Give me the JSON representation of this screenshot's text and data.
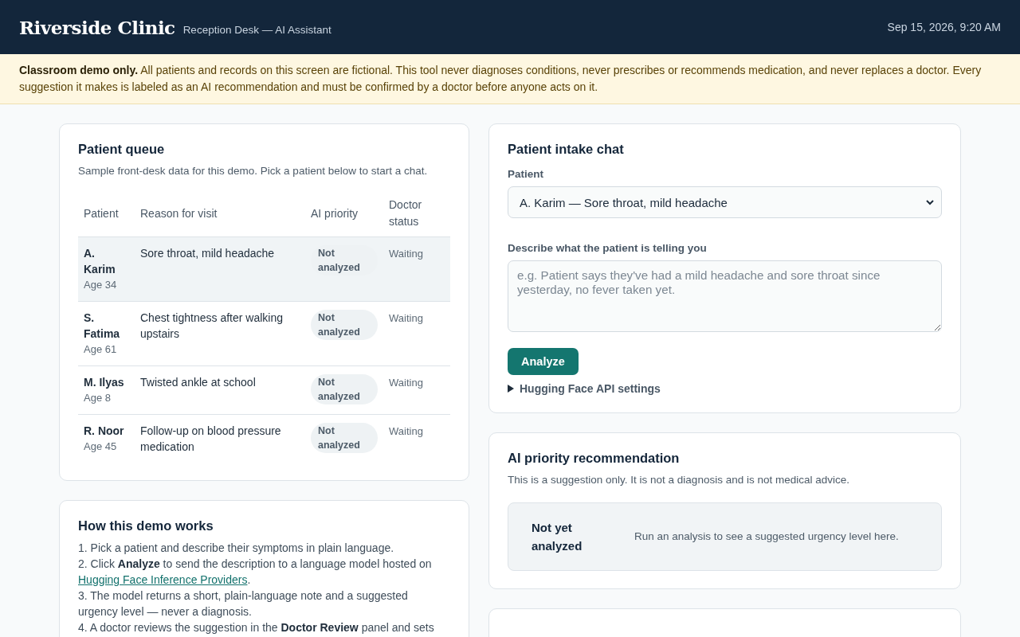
{
  "header": {
    "title": "Riverside Clinic",
    "subtitle": "Reception Desk — AI Assistant",
    "datetime": "Sep 15, 2026, 9:20 AM"
  },
  "notice": {
    "text": "**Classroom demo only.** All patients and records on this screen are fictional. This tool never diagnoses conditions, never prescribes or recommends medication, and never replaces a doctor. Every suggestion it makes is labeled as an AI recommendation and must be confirmed by a doctor before anyone acts on it."
  },
  "queue": {
    "title": "Patient queue",
    "subtitle": "Sample front-desk data for this demo. Pick a patient below to start a chat.",
    "columns": [
      "Patient",
      "Reason for visit",
      "AI priority",
      "Doctor status"
    ],
    "rows": [
      {
        "name": "A. Karim",
        "age": "Age 34",
        "reason": "Sore throat, mild headache",
        "priority": "Not analyzed",
        "status": "Waiting",
        "selected": true
      },
      {
        "name": "S. Fatima",
        "age": "Age 61",
        "reason": "Chest tightness after walking upstairs",
        "priority": "Not analyzed",
        "status": "Waiting",
        "selected": false
      },
      {
        "name": "M. Ilyas",
        "age": "Age 8",
        "reason": "Twisted ankle at school",
        "priority": "Not analyzed",
        "status": "Waiting",
        "selected": false
      },
      {
        "name": "R. Noor",
        "age": "Age 45",
        "reason": "Follow-up on blood pressure medication",
        "priority": "Not analyzed",
        "status": "Waiting",
        "selected": false
      }
    ]
  },
  "how": {
    "title": "How this demo works",
    "steps": [
      {
        "text": "1. Pick a patient and describe their symptoms in plain language."
      },
      {
        "text": "2. Click **Analyze** to send the description to a language model hosted on",
        "link": "Hugging Face Inference Providers",
        "after": "."
      },
      {
        "text": "3. The model returns a short, plain-language note and a suggested urgency level — never a diagnosis."
      },
      {
        "text": "4. A doctor reviews the suggestion in the **Doctor Review** panel and sets"
      }
    ]
  },
  "intake": {
    "title": "Patient intake chat",
    "patient_label": "Patient",
    "patient_value": "A. Karim — Sore throat, mild headache",
    "describe_label": "Describe what the patient is telling you",
    "placeholder": "e.g. Patient says they've had a mild headache and sore throat since yesterday, no fever taken yet.",
    "button": "Analyze",
    "settings": {
      "label": "Hugging Face API settings",
      "expanded": false
    }
  },
  "recommendation": {
    "title": "AI priority recommendation",
    "note": "This is a suggestion only. It is not a diagnosis and is not medical advice.",
    "status": "Not yet analyzed",
    "message": "Run an analysis to see a suggested urgency level here."
  }
}
